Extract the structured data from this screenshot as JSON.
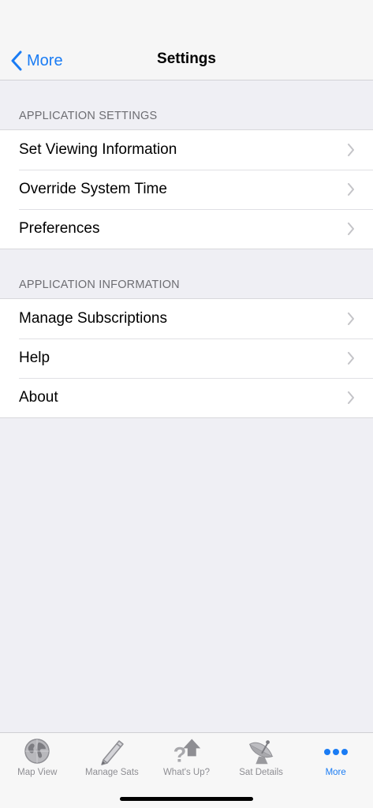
{
  "nav": {
    "back_label": "More",
    "title": "Settings"
  },
  "sections": [
    {
      "header": "APPLICATION SETTINGS",
      "items": [
        {
          "label": "Set Viewing Information"
        },
        {
          "label": "Override System Time"
        },
        {
          "label": "Preferences"
        }
      ]
    },
    {
      "header": "APPLICATION INFORMATION",
      "items": [
        {
          "label": "Manage Subscriptions"
        },
        {
          "label": "Help"
        },
        {
          "label": "About"
        }
      ]
    }
  ],
  "tabbar": {
    "tabs": [
      {
        "label": "Map View",
        "icon": "globe-icon"
      },
      {
        "label": "Manage Sats",
        "icon": "pencil-icon"
      },
      {
        "label": "What's Up?",
        "icon": "question-up-arrow-icon"
      },
      {
        "label": "Sat Details",
        "icon": "satellite-dish-icon"
      },
      {
        "label": "More",
        "icon": "more-dots-icon",
        "active": true
      }
    ]
  },
  "colors": {
    "accent": "#1a7cf4",
    "background": "#efeff4",
    "inactive_tab": "#8e8e93"
  }
}
